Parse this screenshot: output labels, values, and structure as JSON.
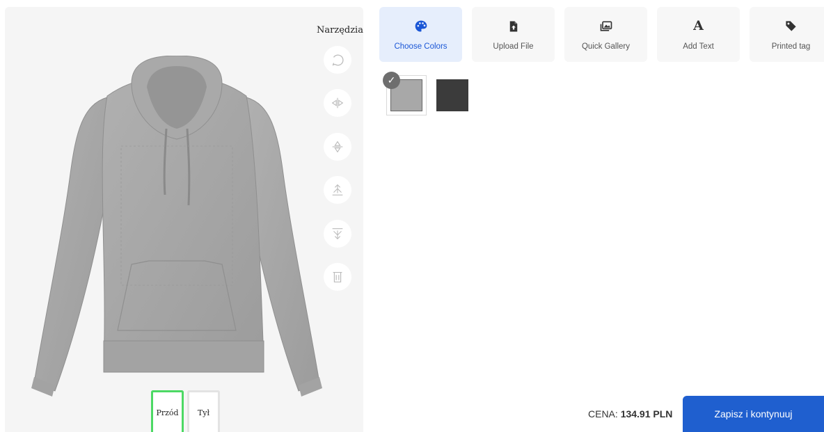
{
  "canvas": {
    "tools_title": "Narzędzia",
    "tools": [
      {
        "icon": "rotate-icon"
      },
      {
        "icon": "flip-horizontal-icon"
      },
      {
        "icon": "flip-vertical-icon"
      },
      {
        "icon": "bring-forward-icon"
      },
      {
        "icon": "send-backward-icon"
      },
      {
        "icon": "trash-icon"
      }
    ],
    "sides": [
      {
        "label": "Przód",
        "active": true
      },
      {
        "label": "Tył",
        "active": false
      }
    ],
    "product_color": "#a6a6a6"
  },
  "tabs": [
    {
      "label": "Choose Colors",
      "icon": "palette-icon",
      "active": true
    },
    {
      "label": "Upload File",
      "icon": "upload-file-icon",
      "active": false
    },
    {
      "label": "Quick Gallery",
      "icon": "gallery-icon",
      "active": false
    },
    {
      "label": "Add Text",
      "icon": "text-icon",
      "active": false
    },
    {
      "label": "Printed tag",
      "icon": "tag-icon",
      "active": false
    }
  ],
  "swatches": [
    {
      "color": "#a8a8a8",
      "selected": true
    },
    {
      "color": "#3b3b3b",
      "selected": false
    }
  ],
  "footer": {
    "price_label": "CENA:",
    "price_value": "134.91 PLN",
    "save_label": "Zapisz i kontynuuj"
  },
  "colors": {
    "accent": "#1f5fcf",
    "active_tab_bg": "#e6eefc",
    "active_side_border": "#4cd964"
  }
}
